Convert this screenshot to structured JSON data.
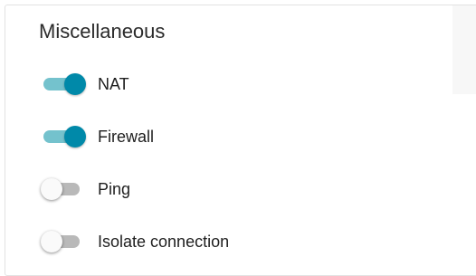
{
  "section": {
    "title": "Miscellaneous"
  },
  "settings": [
    {
      "label": "NAT",
      "enabled": true
    },
    {
      "label": "Firewall",
      "enabled": true
    },
    {
      "label": "Ping",
      "enabled": false
    },
    {
      "label": "Isolate connection",
      "enabled": false
    }
  ],
  "colors": {
    "toggle_on_knob": "#0089a9",
    "toggle_on_track": "#74c2cd",
    "toggle_off_knob": "#fafafa",
    "toggle_off_track": "#b9b9b9"
  }
}
